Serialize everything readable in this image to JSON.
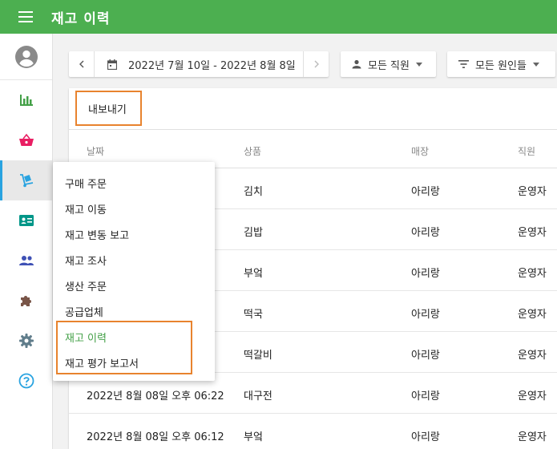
{
  "header": {
    "title": "재고 이력"
  },
  "toolbar": {
    "date_range": "2022년 7월 10일 - 2022년 8월 8일",
    "employee_filter": "모든 직원",
    "reason_filter": "모든 원인들"
  },
  "export_label": "내보내기",
  "table": {
    "columns": [
      "날짜",
      "상품",
      "매장",
      "직원"
    ],
    "rows": [
      {
        "date": "",
        "item": "김치",
        "store": "아리랑",
        "staff": "운영자"
      },
      {
        "date": "",
        "item": "김밥",
        "store": "아리랑",
        "staff": "운영자"
      },
      {
        "date": "",
        "item": "부엌",
        "store": "아리랑",
        "staff": "운영자"
      },
      {
        "date": "",
        "item": "떡국",
        "store": "아리랑",
        "staff": "운영자"
      },
      {
        "date": "",
        "item": "떡갈비",
        "store": "아리랑",
        "staff": "운영자"
      },
      {
        "date": "2022년 8월 08일 오후 06:22",
        "item": "대구전",
        "store": "아리랑",
        "staff": "운영자"
      },
      {
        "date": "2022년 8월 08일 오후 06:12",
        "item": "부엌",
        "store": "아리랑",
        "staff": "운영자"
      }
    ]
  },
  "dropdown": {
    "items": [
      "구매 주문",
      "재고 이동",
      "재고 변동 보고",
      "재고 조사",
      "생산 주문",
      "공급업체",
      "재고 이력",
      "재고 평가 보고서"
    ],
    "active_index": 6
  },
  "sidebar": {
    "icons": [
      "account-icon",
      "reports-icon",
      "items-basket-icon",
      "inventory-dolly-icon",
      "customer-card-icon",
      "employees-icon",
      "integrations-puzzle-icon",
      "settings-gear-icon",
      "help-icon"
    ]
  },
  "colors": {
    "appbar": "#4caf50",
    "active_accent": "#29a3e0",
    "highlight_box": "#e8832e",
    "active_menu_text": "#43a047"
  }
}
